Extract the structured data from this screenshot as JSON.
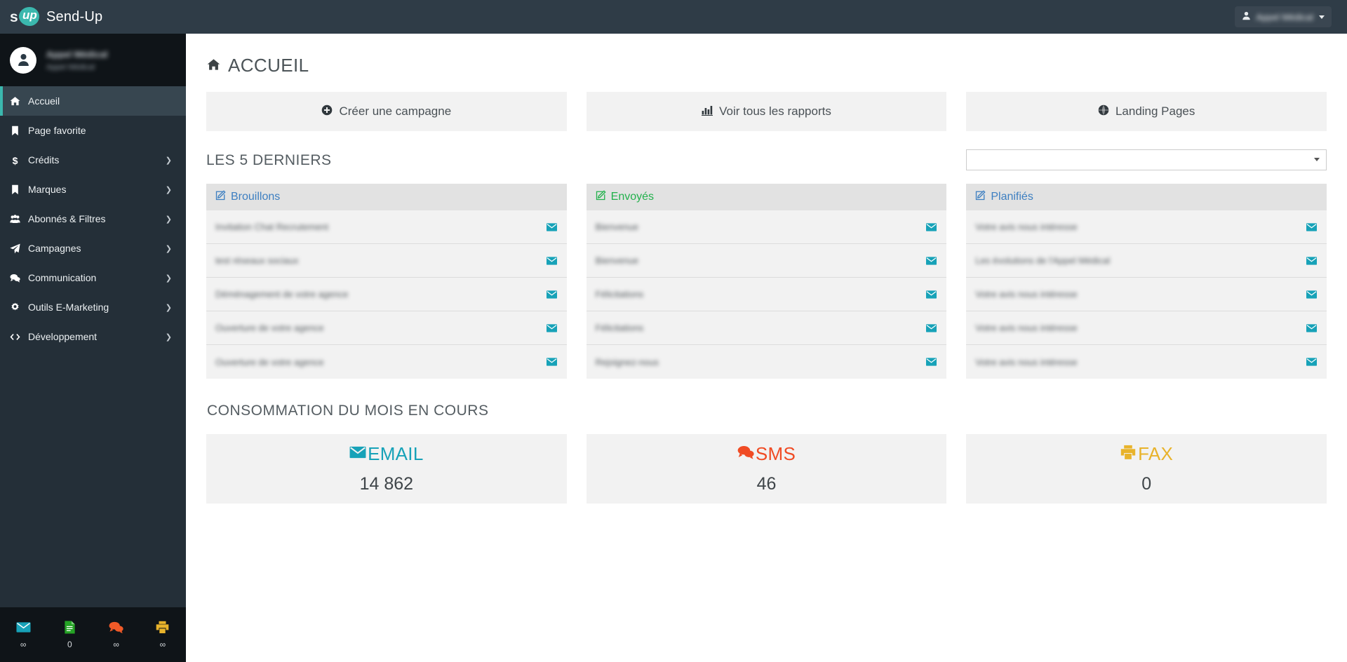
{
  "navbar": {
    "brand_s": "s",
    "brand_up": "up",
    "brand_name": "Send-Up",
    "user_menu": {
      "label": "Appel Médical",
      "icon": "user-icon",
      "caret": "chevron-down-icon"
    }
  },
  "sidebar": {
    "user": {
      "name": "Appel Médical",
      "subtitle": "Appel Médical",
      "avatar_icon": "user-avatar-icon"
    },
    "items": [
      {
        "label": "Accueil",
        "icon": "home-icon",
        "active": true,
        "arrow": ""
      },
      {
        "label": "Page favorite",
        "icon": "bookmark-icon",
        "active": false,
        "arrow": ""
      },
      {
        "label": "Crédits",
        "icon": "dollar-icon",
        "active": false,
        "arrow": "❯"
      },
      {
        "label": "Marques",
        "icon": "bookmark-icon",
        "active": false,
        "arrow": "❯"
      },
      {
        "label": "Abonnés & Filtres",
        "icon": "users-icon",
        "active": false,
        "arrow": "❯"
      },
      {
        "label": "Campagnes",
        "icon": "paper-plane-icon",
        "active": false,
        "arrow": "❯"
      },
      {
        "label": "Communication",
        "icon": "comments-icon",
        "active": false,
        "arrow": "❯"
      },
      {
        "label": "Outils E-Marketing",
        "icon": "gear-icon",
        "active": false,
        "arrow": "❯"
      },
      {
        "label": "Développement",
        "icon": "code-icon",
        "active": false,
        "arrow": "❯"
      }
    ],
    "bottom_stats": [
      {
        "icon": "envelope-icon",
        "color": "#17a2b8",
        "value": "∞"
      },
      {
        "icon": "file-text-icon",
        "color": "#25a325",
        "value": "0"
      },
      {
        "icon": "comments-icon",
        "color": "#f05a28",
        "value": "∞"
      },
      {
        "icon": "print-icon",
        "color": "#e8b32b",
        "value": "∞"
      }
    ]
  },
  "main": {
    "page_title": "ACCUEIL",
    "page_title_icon": "home-icon",
    "actions": [
      {
        "label": "Créer une campagne",
        "icon": "plus-circle-icon"
      },
      {
        "label": "Voir tous les rapports",
        "icon": "bar-chart-icon"
      },
      {
        "label": "Landing Pages",
        "icon": "globe-icon"
      }
    ],
    "section_latest_title": "LES 5 DERNIERS",
    "filter_select": {
      "value": "",
      "placeholder": ""
    },
    "lists": [
      {
        "title": "Brouillons",
        "title_color": "#3d7fc1",
        "icon": "edit-icon",
        "rows": [
          {
            "text": "Invitation Chat Recrutement",
            "icon": "envelope-icon"
          },
          {
            "text": "test réseaux sociaux",
            "icon": "envelope-icon"
          },
          {
            "text": "Déménagement de votre agence",
            "icon": "envelope-icon"
          },
          {
            "text": "Ouverture de votre agence",
            "icon": "envelope-icon"
          },
          {
            "text": "Ouverture de votre agence",
            "icon": "envelope-icon"
          }
        ]
      },
      {
        "title": "Envoyés",
        "title_color": "#22b14c",
        "icon": "edit-icon",
        "rows": [
          {
            "text": "Bienvenue",
            "icon": "envelope-icon"
          },
          {
            "text": "Bienvenue",
            "icon": "envelope-icon"
          },
          {
            "text": "Félicitations",
            "icon": "envelope-icon"
          },
          {
            "text": "Félicitations",
            "icon": "envelope-icon"
          },
          {
            "text": "Rejoignez-nous",
            "icon": "envelope-icon"
          }
        ]
      },
      {
        "title": "Planifiés",
        "title_color": "#3d7fc1",
        "icon": "edit-icon",
        "rows": [
          {
            "text": "Votre avis nous intéresse",
            "icon": "envelope-icon"
          },
          {
            "text": "Les évolutions de l'Appel Médical",
            "icon": "envelope-icon"
          },
          {
            "text": "Votre avis nous intéresse",
            "icon": "envelope-icon"
          },
          {
            "text": "Votre avis nous intéresse",
            "icon": "envelope-icon"
          },
          {
            "text": "Votre avis nous intéresse",
            "icon": "envelope-icon"
          }
        ]
      }
    ],
    "section_consumption_title": "CONSOMMATION DU MOIS EN COURS",
    "stats": [
      {
        "label": "EMAIL",
        "value": "14 862",
        "color": "#17a2b8",
        "icon": "envelope-icon"
      },
      {
        "label": "SMS",
        "value": "46",
        "color": "#f04b24",
        "icon": "comments-icon"
      },
      {
        "label": "FAX",
        "value": "0",
        "color": "#e8b32b",
        "icon": "print-icon"
      }
    ]
  }
}
